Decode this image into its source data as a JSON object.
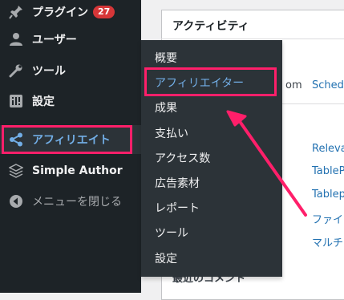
{
  "sidebar": {
    "items": [
      {
        "label": "プラグイン",
        "badge": "27",
        "icon": "plugin-icon"
      },
      {
        "label": "ユーザー",
        "icon": "user-icon"
      },
      {
        "label": "ツール",
        "icon": "wrench-icon"
      },
      {
        "label": "設定",
        "icon": "settings-icon"
      },
      {
        "label": "アフィリエイト",
        "icon": "share-icon"
      },
      {
        "label": "Simple Author",
        "icon": "stack-icon"
      },
      {
        "label": "メニューを閉じる",
        "icon": "collapse-icon"
      }
    ]
  },
  "submenu": {
    "items": [
      {
        "label": "概要"
      },
      {
        "label": "アフィリエイター"
      },
      {
        "label": "成果"
      },
      {
        "label": "支払い"
      },
      {
        "label": "アクセス数"
      },
      {
        "label": "広告素材"
      },
      {
        "label": "レポート"
      },
      {
        "label": "ツール"
      },
      {
        "label": "設定"
      }
    ]
  },
  "main": {
    "panel_title": "アクティビティ",
    "partial_text_1": "om",
    "partial_link_1": "Sched",
    "links": [
      "Releva",
      "TableP",
      "Tablep",
      "ファイ",
      "マルチ"
    ],
    "bottom_text": "最近のコメント"
  },
  "colors": {
    "sidebar_bg": "#1d2327",
    "submenu_bg": "#2c3338",
    "accent": "#72aee6",
    "highlight": "#ff1f6a",
    "badge": "#d63638"
  }
}
